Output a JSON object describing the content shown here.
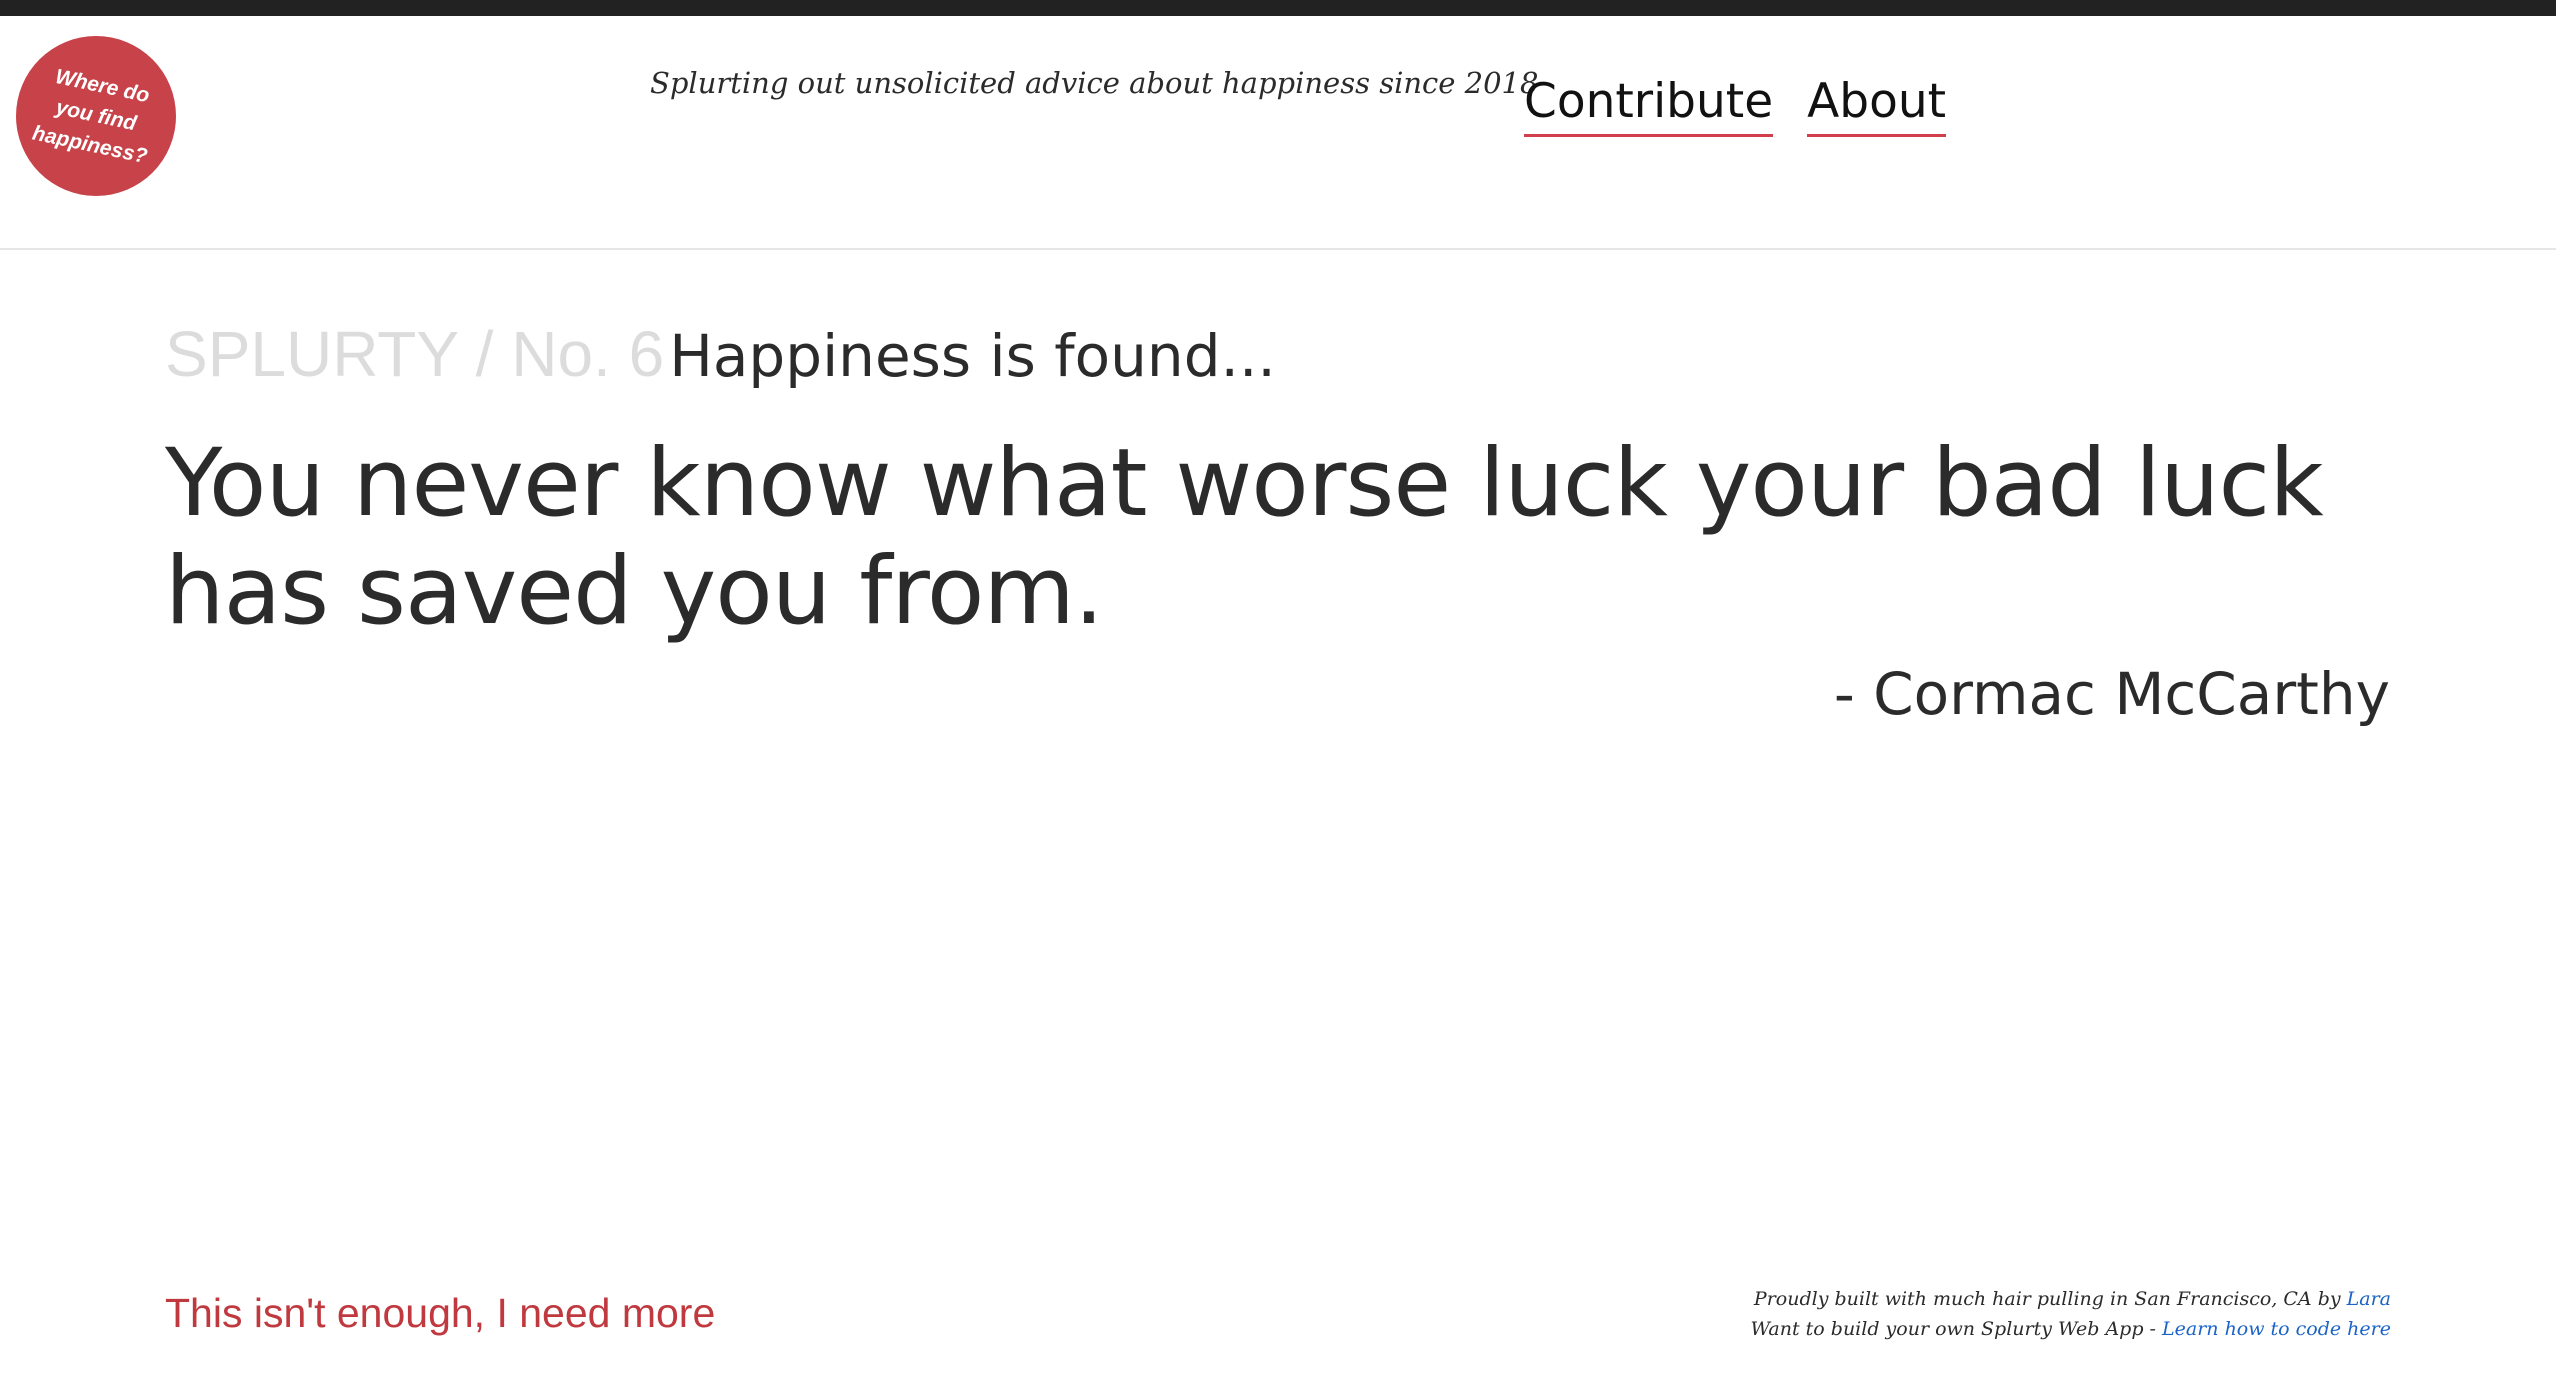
{
  "logo": {
    "text": "Where do you find happiness?",
    "color": "#c8424a"
  },
  "header": {
    "tagline": "Splurting out unsolicited advice about happiness since 2018"
  },
  "nav": {
    "items": [
      {
        "label": "Contribute"
      },
      {
        "label": "About"
      }
    ],
    "underline_color": "#d1404a"
  },
  "splurty": {
    "brand": "SPLURTY / No. 6",
    "heading": "Happiness is found...",
    "quote": "You never know what worse luck your bad luck has saved you from.",
    "author": "- Cormac McCarthy"
  },
  "more_link": {
    "label": "This isn't enough, I need more",
    "color": "#c0393f"
  },
  "footer": {
    "line1_text": "Proudly built with much hair pulling in San Francisco, CA by",
    "line1_link": "Lara",
    "line2_text": "Want to build your own Splurty Web App -",
    "line2_link": "Learn how to code here",
    "link_color": "#1b63c6"
  }
}
